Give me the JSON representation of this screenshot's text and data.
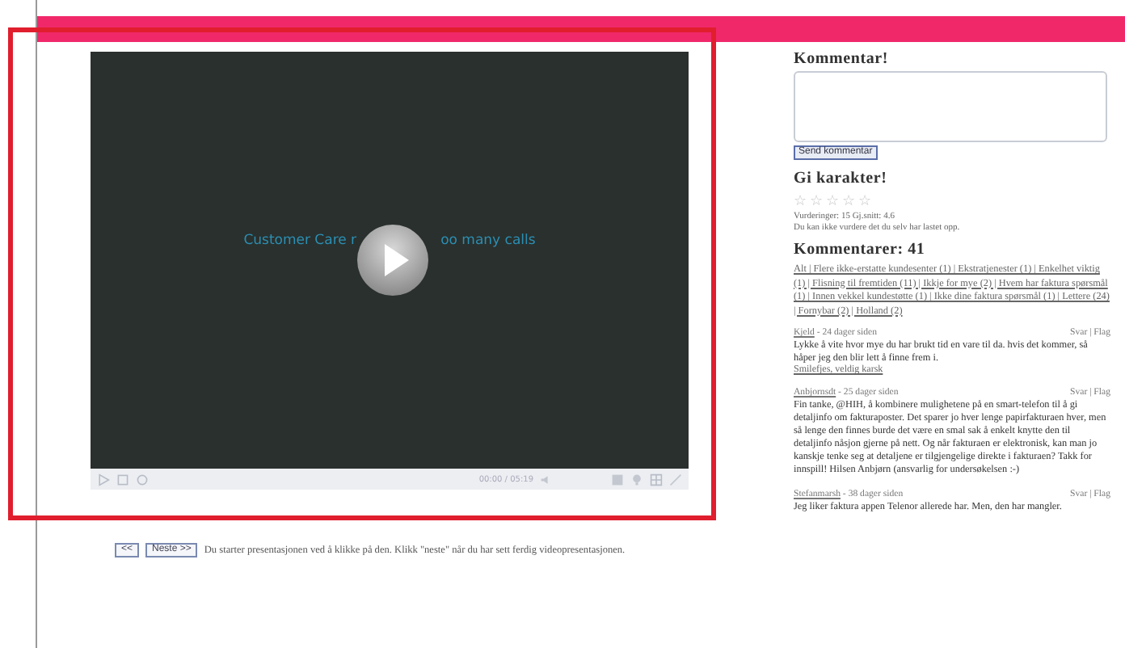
{
  "video": {
    "caption_start": "Customer Care r",
    "caption_end": "oo many calls",
    "time": "00:00 / 05:19"
  },
  "navigation": {
    "buttons": [
      "<<",
      "Neste >>"
    ],
    "hint": "Du starter presentasjonen ved å klikke på den. Klikk \"neste\" når du har sett ferdig videopresentasjonen."
  },
  "comment_form": {
    "title": "Kommentar!",
    "submit": "Send kommentar"
  },
  "rating": {
    "title": "Gi karakter!",
    "stars": 0,
    "summary": "Vurderinger: 15 Gj.snitt: 4.6",
    "note": "Du kan ikke vurdere det du selv har lastet opp."
  },
  "comments": {
    "title": "Kommentarer: 41",
    "filter": "Alt | Flere ikke-erstatte kundesenter (1) | Ekstratjenester (1) | Enkelhet viktig (1) | Flisning til fremtiden (11) | Ikkje for mye (2) | Hvem har faktura spørsmål (1) | Innen vekkel kundestøtte (1) | Ikke dine faktura spørsmål (1) | Lettere (24) | Fornybar (2) | Holland (2)",
    "items": [
      {
        "author": "Kjeld",
        "age": " - 24 dager siden",
        "actions": "Svar | Flag",
        "body": "Lykke å vite hvor mye du har brukt tid en vare til da. hvis det kommer, så håper jeg den blir lett å finne frem i.",
        "tags": "Smilefjes, veldig karsk"
      },
      {
        "author": "Anbjornsdt",
        "age": " - 25 dager siden",
        "actions": "Svar | Flag",
        "body": "Fin tanke, @HIH, å kombinere mulighetene på en smart-telefon til å gi detaljinfo om fakturaposter. Det sparer jo hver lenge papirfakturaen hver, men så lenge den finnes burde det være en smal sak å enkelt knytte den til detaljinfo nåsjon gjerne på nett. Og når fakturaen er elektronisk, kan man jo kanskje tenke seg at detaljene er tilgjengelige direkte i fakturaen? Takk for innspill! Hilsen Anbjørn (ansvarlig for undersøkelsen :-)"
      },
      {
        "author": "Stefanmarsh",
        "age": " - 38 dager siden",
        "actions": "Svar | Flag",
        "body": "Jeg liker faktura appen Telenor allerede har. Men, den har mangler."
      }
    ]
  }
}
